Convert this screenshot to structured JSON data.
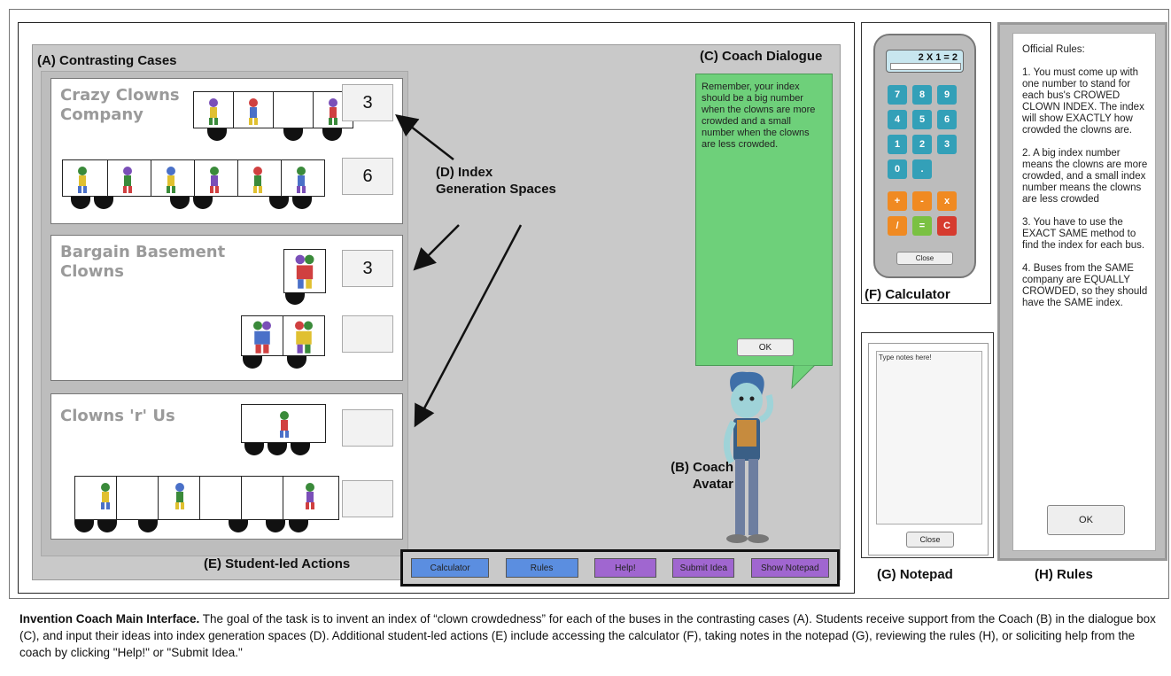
{
  "labels": {
    "contrasting_cases": "(A) Contrasting Cases",
    "coach_dialogue": "(C) Coach Dialogue",
    "index_gen": [
      "(D) Index",
      "Generation Spaces"
    ],
    "coach_avatar": [
      "(B) Coach",
      "Avatar"
    ],
    "student_actions": "(E) Student-led Actions",
    "calculator": "(F) Calculator",
    "notepad": "(G) Notepad",
    "rules": "(H) Rules"
  },
  "companies": [
    {
      "name": [
        "Crazy Clowns",
        "Company"
      ],
      "indices": [
        "3",
        "6"
      ]
    },
    {
      "name": [
        "Bargain Basement",
        "Clowns"
      ],
      "indices": [
        "3",
        ""
      ]
    },
    {
      "name": [
        "Clowns 'r' Us"
      ],
      "indices": [
        "",
        ""
      ]
    }
  ],
  "coach": {
    "message": "Remember, your index should be a big number when the clowns are more crowded and a small number when the clowns are less crowded.",
    "ok_label": "OK"
  },
  "actions": [
    "Calculator",
    "Rules",
    "Help!",
    "Submit Idea",
    "Show Notepad"
  ],
  "calculator": {
    "display": "2 X 1 = 2",
    "keys": [
      "7",
      "8",
      "9",
      "4",
      "5",
      "6",
      "1",
      "2",
      "3",
      "0",
      ".",
      "+",
      "-",
      "x",
      "/",
      "=",
      "C"
    ],
    "close_label": "Close"
  },
  "notepad": {
    "placeholder": "Type notes here!",
    "close_label": "Close"
  },
  "rules": {
    "title": "Official Rules:",
    "items": [
      "1. You must come up with one number to stand for each bus's CROWED CLOWN INDEX. The index will show EXACTLY how crowded the clowns are.",
      "2. A big index number means the clowns are more crowded, and a small index number means the clowns are less crowded",
      "3. You have to use the EXACT SAME method to find the index for each bus.",
      "4. Buses from the SAME company are EQUALLY CROWDED, so they should have the SAME index."
    ],
    "ok_label": "OK"
  },
  "caption": {
    "bold": "Invention Coach Main Interface.",
    "text": " The goal of the task is to invent an index of “clown crowdedness” for each of the buses in the contrasting cases (A). Students receive support from the Coach (B) in the dialogue box (C), and input their ideas into index generation spaces (D). Additional student-led actions (E) include accessing the calculator (F), taking notes in the notepad (G), reviewing the rules (H), or soliciting help from the coach by clicking \"Help!\" or \"Submit Idea.\""
  }
}
